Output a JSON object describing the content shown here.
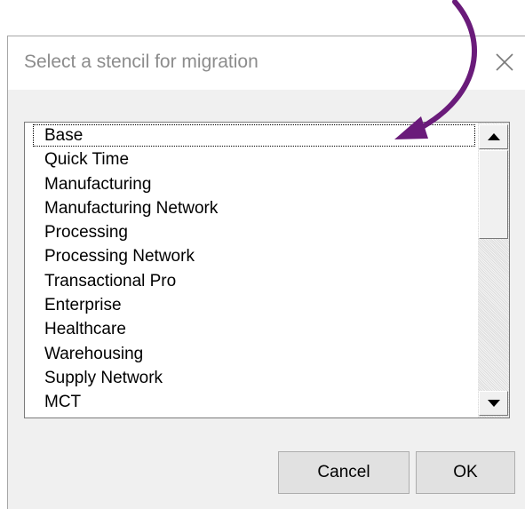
{
  "dialog": {
    "title": "Select a stencil for migration",
    "close_icon": "close-icon"
  },
  "stencil_list": {
    "items": [
      "Base",
      "Quick Time",
      "Manufacturing",
      "Manufacturing Network",
      "Processing",
      "Processing Network",
      "Transactional Pro",
      "Enterprise",
      "Healthcare",
      "Warehousing",
      "Supply Network",
      "MCT"
    ],
    "focused_item": "Base",
    "scroll_up_icon": "scroll-up-arrow-icon",
    "scroll_down_icon": "scroll-down-arrow-icon"
  },
  "buttons": {
    "cancel_label": "Cancel",
    "ok_label": "OK"
  },
  "annotation": {
    "arrow_color": "#6a1b7a"
  }
}
